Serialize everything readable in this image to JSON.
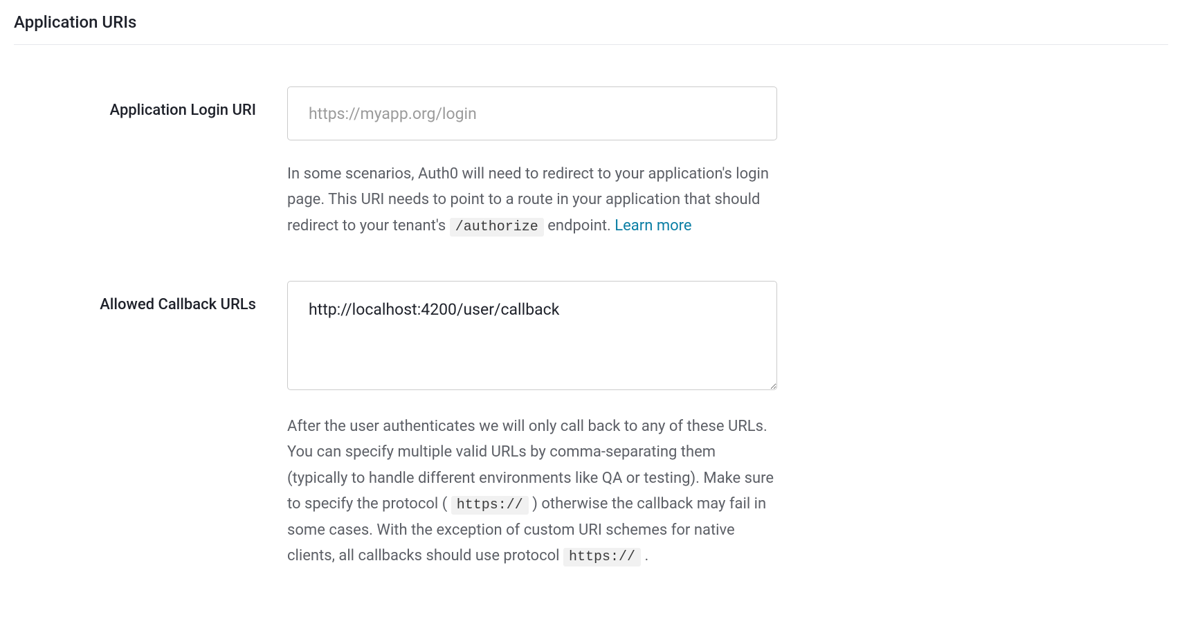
{
  "section": {
    "title": "Application URIs"
  },
  "loginUri": {
    "label": "Application Login URI",
    "placeholder": "https://myapp.org/login",
    "value": "",
    "help_part1": "In some scenarios, Auth0 will need to redirect to your application's login page. This URI needs to point to a route in your application that should redirect to your tenant's ",
    "help_code": "/authorize",
    "help_part2": " endpoint. ",
    "learn_more": "Learn more"
  },
  "callbackUrls": {
    "label": "Allowed Callback URLs",
    "value": "http://localhost:4200/user/callback",
    "help_part1": "After the user authenticates we will only call back to any of these URLs. You can specify multiple valid URLs by comma-separating them (typically to handle different environments like QA or testing). Make sure to specify the protocol (",
    "help_code1": "https://",
    "help_part2": ") otherwise the callback may fail in some cases. With the exception of custom URI schemes for native clients, all callbacks should use protocol ",
    "help_code2": "https://",
    "help_part3": "."
  }
}
